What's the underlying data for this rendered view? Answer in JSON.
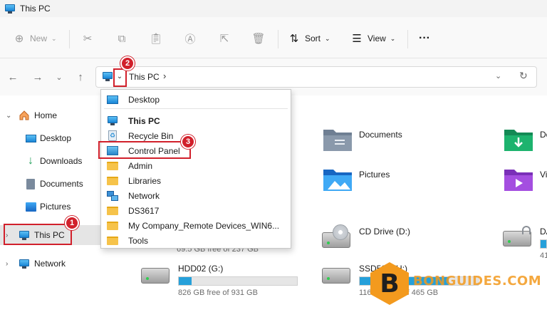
{
  "window": {
    "title": "This PC"
  },
  "toolbar": {
    "new_label": "New",
    "sort_label": "Sort",
    "view_label": "View",
    "more_label": "···"
  },
  "address": {
    "location": "This PC",
    "separator": "›"
  },
  "sidebar": {
    "items": [
      {
        "label": "Home"
      },
      {
        "label": "Desktop"
      },
      {
        "label": "Downloads"
      },
      {
        "label": "Documents"
      },
      {
        "label": "Pictures"
      },
      {
        "label": "This PC"
      },
      {
        "label": "Network"
      }
    ]
  },
  "dropdown": {
    "items": [
      {
        "label": "Desktop"
      },
      {
        "label": "This PC"
      },
      {
        "label": "Recycle Bin"
      },
      {
        "label": "Control Panel"
      },
      {
        "label": "Admin"
      },
      {
        "label": "Libraries"
      },
      {
        "label": "Network"
      },
      {
        "label": "DS3617"
      },
      {
        "label": "My Company_Remote Devices_WIN6..."
      },
      {
        "label": "Tools"
      }
    ]
  },
  "content": {
    "folders": [
      {
        "label": "Documents"
      },
      {
        "label": "Do"
      },
      {
        "label": "Pictures"
      },
      {
        "label": "Vi"
      }
    ],
    "drives": [
      {
        "label": "CD Drive (D:)"
      },
      {
        "label": "DA",
        "sub": "41"
      },
      {
        "label": "HDD02 (G:)",
        "sub": "826 GB free of 931 GB",
        "used_fraction": 0.11
      },
      {
        "label": "SSD500 (H:)",
        "sub": "116 GB free of 465 GB",
        "used_fraction": 0.75
      }
    ],
    "partial_sub": "69.5 GB free of 237 GB"
  },
  "annotations": {
    "b1": "1",
    "b2": "2",
    "b3": "3"
  },
  "watermark": {
    "letter": "B",
    "text": "BONGUIDES.COM"
  },
  "colors": {
    "highlight": "#d1202b",
    "accent": "#26a0da",
    "watermark": "#f39a1e"
  }
}
